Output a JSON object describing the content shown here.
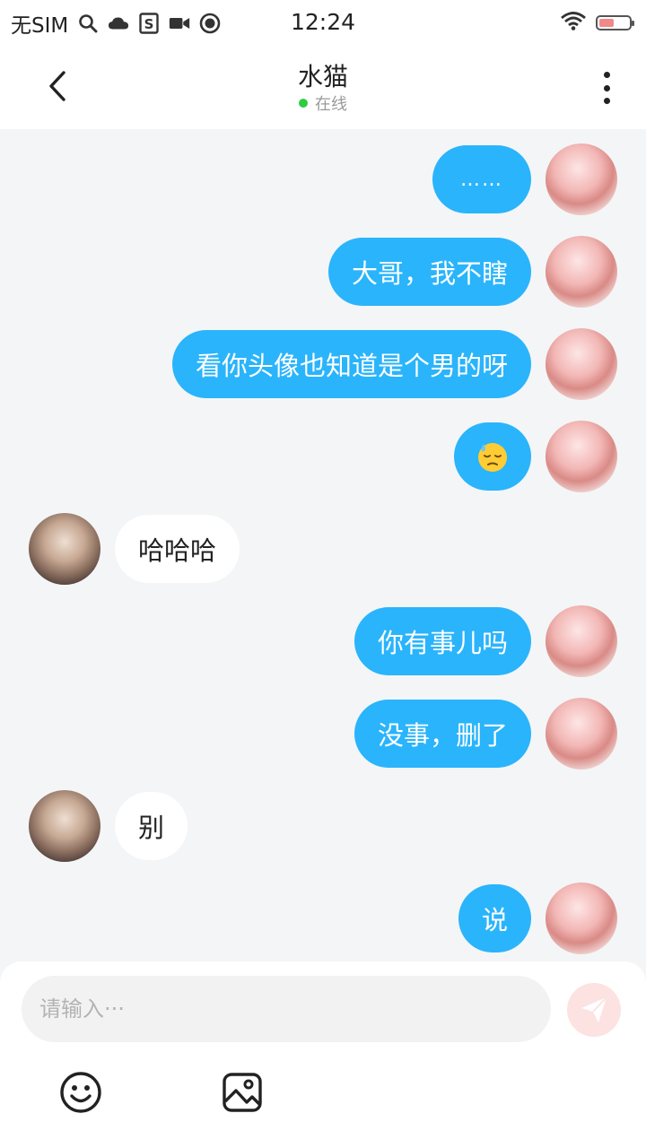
{
  "status_bar": {
    "carrier": "无SIM",
    "time": "12:24",
    "icons": [
      "search-icon",
      "cloud-icon",
      "s-icon",
      "video-icon",
      "play-icon",
      "wifi-icon",
      "battery-icon"
    ]
  },
  "header": {
    "back_icon": "chevron-left-icon",
    "title": "水猫",
    "status": "在线",
    "status_color": "#2ecc40",
    "more_icon": "more-vertical-icon"
  },
  "messages": [
    {
      "side": "me",
      "text": "……"
    },
    {
      "side": "me",
      "text": "大哥，我不瞎"
    },
    {
      "side": "me",
      "text": "看你头像也知道是个男的呀"
    },
    {
      "side": "me",
      "emoji": "downcast-sweat-face"
    },
    {
      "side": "other",
      "text": "哈哈哈"
    },
    {
      "side": "me",
      "text": "你有事儿吗"
    },
    {
      "side": "me",
      "text": "没事，删了"
    },
    {
      "side": "other",
      "text": "别"
    },
    {
      "side": "me",
      "text": "说"
    }
  ],
  "composer": {
    "placeholder": "请输入···",
    "value": "",
    "send_icon": "send-icon",
    "tools": [
      "emoji-icon",
      "image-icon"
    ]
  },
  "colors": {
    "my_bubble": "#2ab4fb",
    "other_bubble": "#ffffff",
    "background": "#f4f5f7",
    "send_button": "#fde2e2"
  }
}
